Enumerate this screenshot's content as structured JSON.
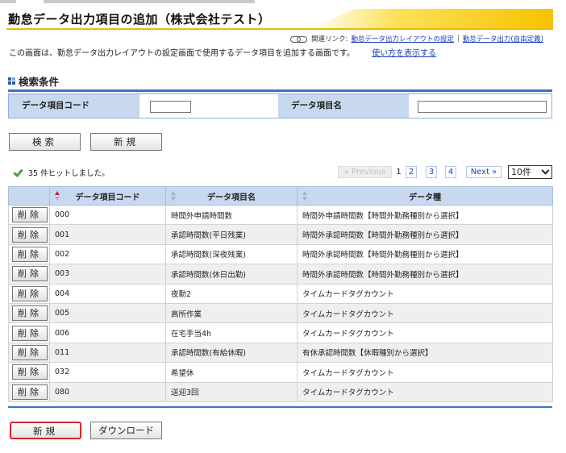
{
  "page": {
    "title": "勤怠データ出力項目の追加（株式会社テスト）",
    "related_label": "関連リンク:",
    "related_links": [
      "勤怠データ出力レイアウトの設定",
      "勤怠データ出力(自由定義)"
    ],
    "related_sep": "|",
    "description": "この画面は、勤怠データ出力レイアウトの設定画面で使用するデータ項目を追加する画面です。",
    "help_link": "使い方を表示する"
  },
  "search": {
    "heading": "検索条件",
    "code_label": "データ項目コード",
    "code_value": "",
    "name_label": "データ項目名",
    "name_value": "",
    "search_button": "検索",
    "new_button": "新規"
  },
  "results": {
    "hit_text": "35 件ヒットしました。",
    "pager": {
      "previous": "« Previous",
      "current": "1",
      "pages": [
        "2",
        "3",
        "4"
      ],
      "next": "Next »"
    },
    "per_page": "10件",
    "columns": [
      "データ項目コード",
      "データ項目名",
      "データ種"
    ],
    "delete_label": "削除",
    "rows": [
      {
        "code": "000",
        "name": "時間外申請時間数",
        "type": "時間外申請時間数【時間外勤務種別から選択】"
      },
      {
        "code": "001",
        "name": "承認時間数(平日残業)",
        "type": "時間外承認時間数【時間外勤務種別から選択】"
      },
      {
        "code": "002",
        "name": "承認時間数(深夜残業)",
        "type": "時間外承認時間数【時間外勤務種別から選択】"
      },
      {
        "code": "003",
        "name": "承認時間数(休日出勤)",
        "type": "時間外承認時間数【時間外勤務種別から選択】"
      },
      {
        "code": "004",
        "name": "夜勤2",
        "type": "タイムカードタグカウント"
      },
      {
        "code": "005",
        "name": "高所作業",
        "type": "タイムカードタグカウント"
      },
      {
        "code": "006",
        "name": "在宅手当4h",
        "type": "タイムカードタグカウント"
      },
      {
        "code": "011",
        "name": "承認時間数(有給休暇)",
        "type": "有休承認時間数【休暇種別から選択】"
      },
      {
        "code": "032",
        "name": "希望休",
        "type": "タイムカードタグカウント"
      },
      {
        "code": "080",
        "name": "送迎3回",
        "type": "タイムカードタグカウント"
      }
    ]
  },
  "footer": {
    "new_button": "新規",
    "download_button": "ダウンロード"
  },
  "colors": {
    "accent_blue": "#3d72c8",
    "header_blue": "#c7d8ef",
    "title_yellow": "#f2b800",
    "highlight_red": "#d9232a"
  }
}
